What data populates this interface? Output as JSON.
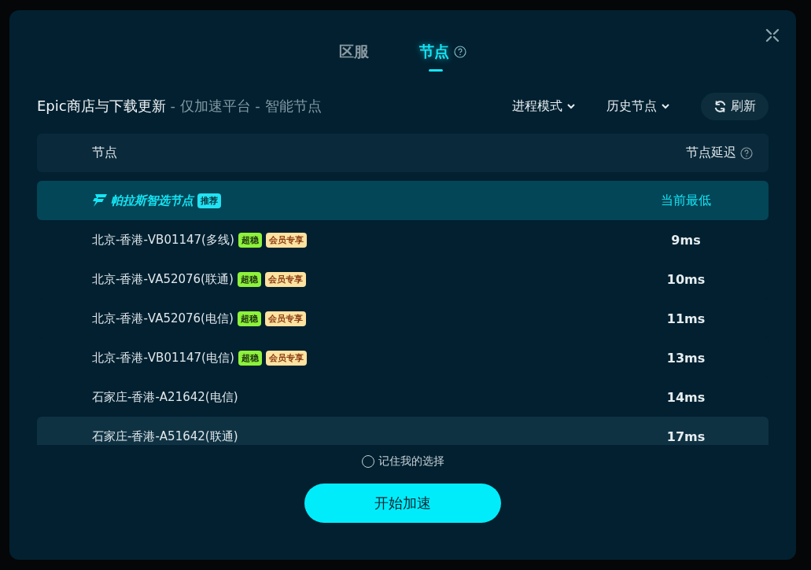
{
  "tabs": [
    {
      "label": "区服",
      "selected": false,
      "help": false
    },
    {
      "label": "节点",
      "selected": true,
      "help": true
    }
  ],
  "title": {
    "main": "Epic商店与下载更新",
    "sub": " - 仅加速平台 - 智能节点"
  },
  "dropdowns": [
    {
      "label": "进程模式"
    },
    {
      "label": "历史节点"
    }
  ],
  "refresh_button": "刷新",
  "columns": [
    {
      "label": "节点",
      "help": false
    },
    {
      "label": "节点延迟",
      "help": true
    }
  ],
  "rows": [
    {
      "kind": "smart",
      "name": "帕拉斯智选节点",
      "badge": {
        "kind": "recommend",
        "label": "推荐"
      },
      "latency": "当前最低",
      "selected": true,
      "hovered": false
    },
    {
      "kind": "node",
      "name": "北京-香港-VB01147(多线)",
      "tags": [
        {
          "kind": "stable",
          "label": "超稳"
        },
        {
          "kind": "vip",
          "label": "会员专享"
        }
      ],
      "latency": "9ms",
      "selected": false,
      "hovered": false
    },
    {
      "kind": "node",
      "name": "北京-香港-VA52076(联通)",
      "tags": [
        {
          "kind": "stable",
          "label": "超稳"
        },
        {
          "kind": "vip",
          "label": "会员专享"
        }
      ],
      "latency": "10ms",
      "selected": false,
      "hovered": false
    },
    {
      "kind": "node",
      "name": "北京-香港-VA52076(电信)",
      "tags": [
        {
          "kind": "stable",
          "label": "超稳"
        },
        {
          "kind": "vip",
          "label": "会员专享"
        }
      ],
      "latency": "11ms",
      "selected": false,
      "hovered": false
    },
    {
      "kind": "node",
      "name": "北京-香港-VB01147(电信)",
      "tags": [
        {
          "kind": "stable",
          "label": "超稳"
        },
        {
          "kind": "vip",
          "label": "会员专享"
        }
      ],
      "latency": "13ms",
      "selected": false,
      "hovered": false
    },
    {
      "kind": "node",
      "name": "石家庄-香港-A21642(电信)",
      "tags": [],
      "latency": "14ms",
      "selected": false,
      "hovered": false
    },
    {
      "kind": "node",
      "name": "石家庄-香港-A51642(联通)",
      "tags": [],
      "latency": "17ms",
      "selected": false,
      "hovered": true
    }
  ],
  "remember": {
    "label": "记住我的选择",
    "checked": false
  },
  "start_button": "开始加速"
}
